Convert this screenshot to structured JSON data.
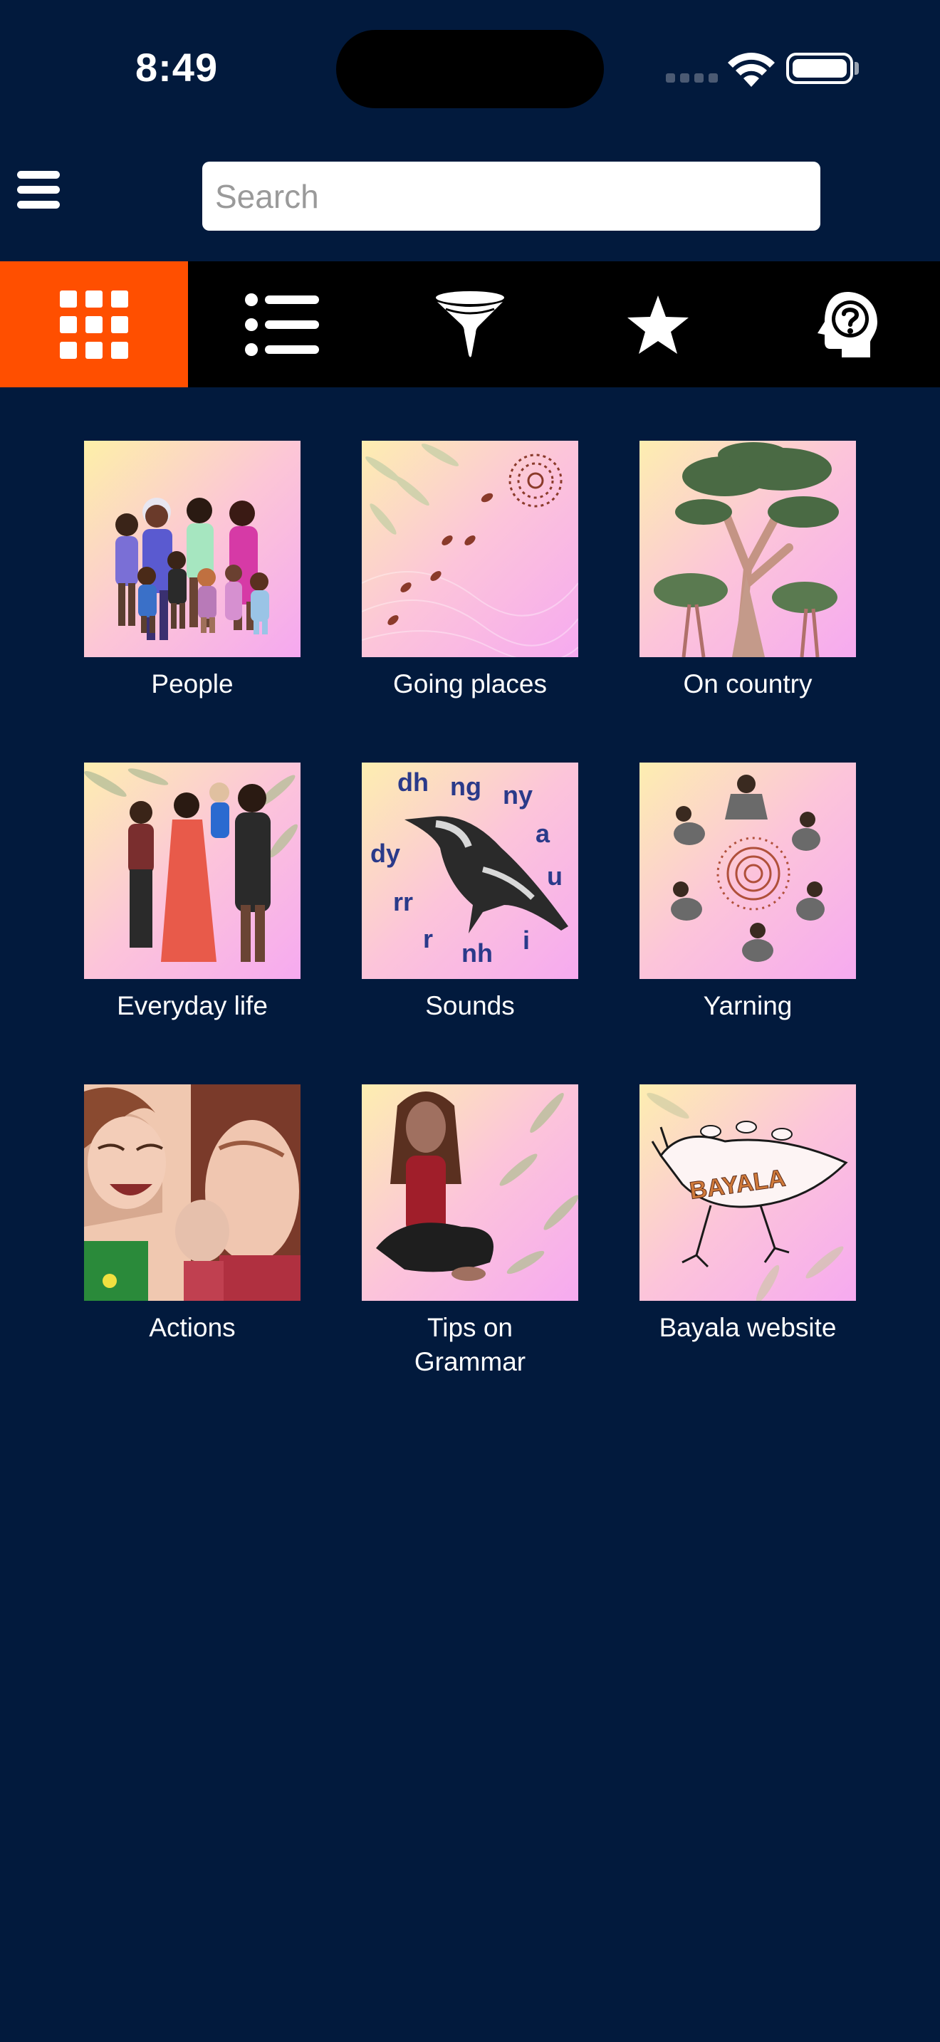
{
  "status": {
    "time": "8:49"
  },
  "search": {
    "placeholder": "Search",
    "value": ""
  },
  "toolbar": {
    "items": [
      {
        "icon": "grid-icon",
        "active": true
      },
      {
        "icon": "list-icon",
        "active": false
      },
      {
        "icon": "filter-funnel-icon",
        "active": false
      },
      {
        "icon": "star-icon",
        "active": false
      },
      {
        "icon": "help-head-icon",
        "active": false
      }
    ],
    "active_color": "#ff4f00"
  },
  "tiles": [
    {
      "label": "People"
    },
    {
      "label": "Going places"
    },
    {
      "label": "On country"
    },
    {
      "label": "Everyday life"
    },
    {
      "label": "Sounds"
    },
    {
      "label": "Yarning"
    },
    {
      "label": "Actions"
    },
    {
      "label": "Tips on\nGrammar"
    },
    {
      "label": "Bayala website"
    }
  ],
  "sounds_tile_letters": [
    "dh",
    "ng",
    "ny",
    "a",
    "dy",
    "u",
    "rr",
    "r",
    "nh",
    "i"
  ],
  "bayala_logo_text": "BAYALA",
  "colors": {
    "background": "#021a3d",
    "toolbar": "#000000",
    "accent": "#ff4f00"
  }
}
